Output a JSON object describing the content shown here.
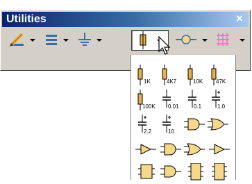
{
  "window": {
    "title": "Utilities",
    "close_glyph": "×"
  },
  "toolbar": {
    "tools": [
      {
        "name": "pen-edit",
        "icon": "pen-edit-icon"
      },
      {
        "name": "resistor-line",
        "icon": "align-lines-icon"
      },
      {
        "name": "ground",
        "icon": "ground-icon"
      },
      {
        "name": "part-library",
        "icon": "component-icon",
        "active": true
      },
      {
        "name": "probe",
        "icon": "probe-icon"
      },
      {
        "name": "grid",
        "icon": "grid-icon"
      }
    ]
  },
  "components": {
    "row1": [
      "1K",
      "4K7",
      "10K",
      "47K"
    ],
    "row2": [
      "100K",
      "0.01",
      "0.1",
      "1.0"
    ],
    "row3": [
      "2.2",
      "10"
    ]
  },
  "colors": {
    "title_bar": "#0a246a",
    "toolbar_bg": "#d4d0c8",
    "resistor_body": "#e8b04a",
    "gate_fill": "#f5d88a",
    "grid_icon": "#ff66cc"
  }
}
